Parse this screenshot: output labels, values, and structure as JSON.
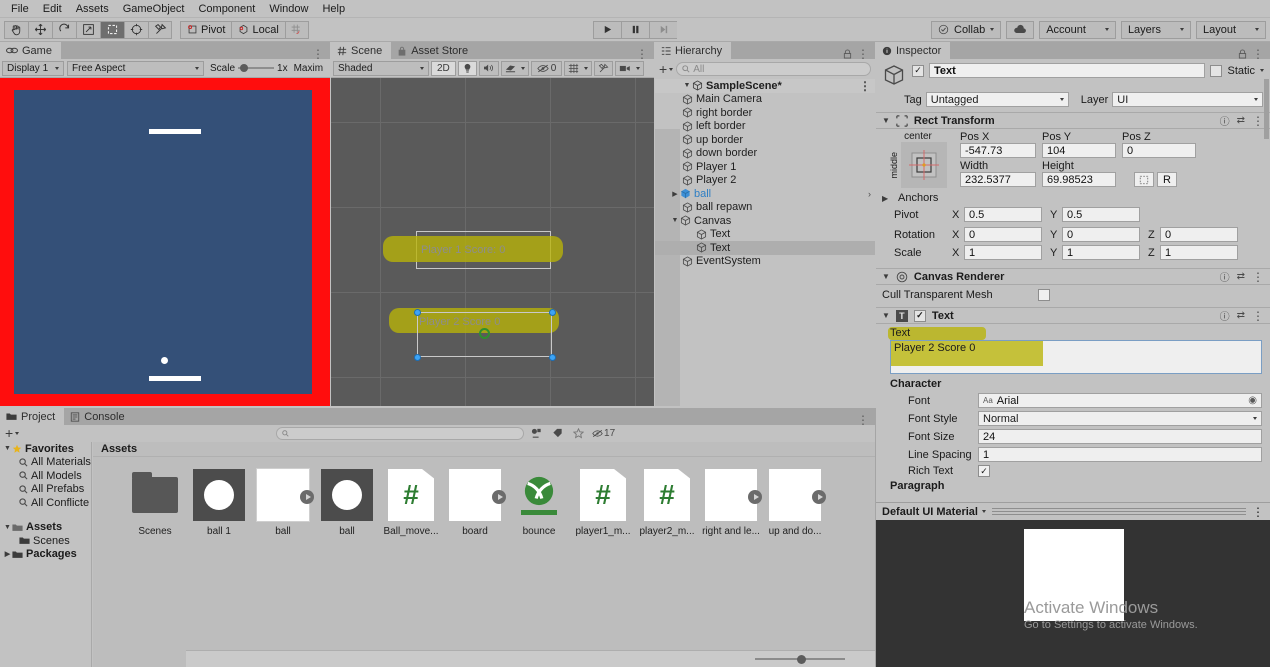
{
  "menubar": {
    "items": [
      "File",
      "Edit",
      "Assets",
      "GameObject",
      "Component",
      "Window",
      "Help"
    ]
  },
  "toolbar": {
    "tools": [
      "hand-tool",
      "move-tool",
      "rotate-tool",
      "scale-tool",
      "rect-tool",
      "transform-tool",
      "custom-tool"
    ],
    "pivot_label": "Pivot",
    "local_label": "Local",
    "play_label": "▶",
    "pause_label": "▐▐",
    "step_label": "▶|",
    "collab_label": "Collab",
    "cloud_label": "cloud-icon",
    "account_label": "Account",
    "layers_label": "Layers",
    "layout_label": "Layout"
  },
  "game_panel": {
    "tab_label": "Game",
    "display_label": "Display 1",
    "aspect_label": "Free Aspect",
    "scale_label": "Scale",
    "scale_value": "1x",
    "maximize_label": "Maxim"
  },
  "scene_panel": {
    "tabs": [
      {
        "label": "Scene",
        "selected": true
      },
      {
        "label": "Asset Store",
        "selected": false
      }
    ],
    "shading_label": "Shaded",
    "mode_2d_label": "2D",
    "light_icon": "lightbulb-icon",
    "audio_icon": "speaker-icon",
    "fx_icon": "effects-icon",
    "hidden_count": "0",
    "grid_icon": "grid-icon",
    "gizmo_icon": "gizmo-icon",
    "camera_icon": "camera-icon",
    "labels": [
      {
        "text": "Player 1 Score: 0"
      },
      {
        "text": "Player 2 Score 0"
      }
    ]
  },
  "hierarchy": {
    "tab_label": "Hierarchy",
    "create_label": "+",
    "search_placeholder": "All",
    "scene_name": "SampleScene*",
    "items": [
      {
        "label": "Main Camera",
        "depth": 1,
        "expandable": false,
        "selected": false,
        "prefab": false
      },
      {
        "label": "right border",
        "depth": 1,
        "expandable": false,
        "selected": false,
        "prefab": false
      },
      {
        "label": "left border",
        "depth": 1,
        "expandable": false,
        "selected": false,
        "prefab": false
      },
      {
        "label": "up border",
        "depth": 1,
        "expandable": false,
        "selected": false,
        "prefab": false
      },
      {
        "label": "down border",
        "depth": 1,
        "expandable": false,
        "selected": false,
        "prefab": false
      },
      {
        "label": "Player 1",
        "depth": 1,
        "expandable": false,
        "selected": false,
        "prefab": false
      },
      {
        "label": "Player 2",
        "depth": 1,
        "expandable": false,
        "selected": false,
        "prefab": false
      },
      {
        "label": "ball",
        "depth": 1,
        "expandable": true,
        "selected": false,
        "prefab": true
      },
      {
        "label": "ball repawn",
        "depth": 1,
        "expandable": false,
        "selected": false,
        "prefab": false
      },
      {
        "label": "Canvas",
        "depth": 1,
        "expandable": true,
        "expanded": true,
        "selected": false,
        "prefab": false
      },
      {
        "label": "Text",
        "depth": 2,
        "expandable": false,
        "selected": false,
        "prefab": false
      },
      {
        "label": "Text",
        "depth": 2,
        "expandable": false,
        "selected": true,
        "prefab": false
      },
      {
        "label": "EventSystem",
        "depth": 1,
        "expandable": false,
        "selected": false,
        "prefab": false
      }
    ]
  },
  "inspector": {
    "tab_label": "Inspector",
    "object_name": "Text",
    "enabled": true,
    "static_label": "Static",
    "tag_label": "Tag",
    "tag_value": "Untagged",
    "layer_label": "Layer",
    "layer_value": "UI",
    "rect_transform": {
      "title": "Rect Transform",
      "anchor_preset_top": "center",
      "anchor_preset_side": "middle",
      "pos_x_label": "Pos X",
      "pos_y_label": "Pos Y",
      "pos_z_label": "Pos Z",
      "pos_x": "-547.73",
      "pos_y": "104",
      "pos_z": "0",
      "width_label": "Width",
      "height_label": "Height",
      "width": "232.5377",
      "height": "69.98523",
      "blueprint_label": "R",
      "anchors_label": "Anchors",
      "pivot_label": "Pivot",
      "pivot_x": "0.5",
      "pivot_y": "0.5",
      "rotation_label": "Rotation",
      "rot_x": "0",
      "rot_y": "0",
      "rot_z": "0",
      "scale_label": "Scale",
      "scale_x": "1",
      "scale_y": "1",
      "scale_z": "1"
    },
    "canvas_renderer": {
      "title": "Canvas Renderer",
      "cull_label": "Cull Transparent Mesh",
      "cull_checked": false
    },
    "text_component": {
      "title": "Text",
      "enabled": true,
      "text_label": "Text",
      "text_value": "Player 2 Score 0",
      "character_label": "Character",
      "font_label": "Font",
      "font_value": "Arial",
      "font_style_label": "Font Style",
      "font_style_value": "Normal",
      "font_size_label": "Font Size",
      "font_size_value": "24",
      "line_spacing_label": "Line Spacing",
      "line_spacing_value": "1",
      "rich_text_label": "Rich Text",
      "rich_text_checked": true,
      "paragraph_label": "Paragraph"
    },
    "material_label": "Default UI Material",
    "watermark_title": "Activate Windows",
    "watermark_sub": "Go to Settings to activate Windows."
  },
  "project": {
    "tabs": [
      {
        "label": "Project",
        "selected": true
      },
      {
        "label": "Console",
        "selected": false
      }
    ],
    "create_label": "+",
    "search_placeholder": "",
    "filter_icons": [
      "asset-filter-icon",
      "label-filter-icon",
      "favorite-star-icon"
    ],
    "hidden_count": "17",
    "tree": [
      {
        "label": "Favorites",
        "bold": true,
        "depth": 0,
        "tri": "▼",
        "star": true
      },
      {
        "label": "All Materials",
        "bold": false,
        "depth": 1,
        "search": true
      },
      {
        "label": "All Models",
        "bold": false,
        "depth": 1,
        "search": true
      },
      {
        "label": "All Prefabs",
        "bold": false,
        "depth": 1,
        "search": true
      },
      {
        "label": "All Conflicte",
        "bold": false,
        "depth": 1,
        "search": true
      },
      {
        "label": "",
        "spacer": true
      },
      {
        "label": "Assets",
        "bold": true,
        "depth": 0,
        "tri": "▼",
        "folder": true
      },
      {
        "label": "Scenes",
        "bold": false,
        "depth": 1,
        "folder": true
      },
      {
        "label": "Packages",
        "bold": true,
        "depth": 0,
        "tri": "▶",
        "folder": true
      }
    ],
    "breadcrumb": "Assets",
    "assets": [
      {
        "name": "Scenes",
        "kind": "folder",
        "selected": false
      },
      {
        "name": "ball 1",
        "kind": "sprite-dark",
        "selected": false
      },
      {
        "name": "ball",
        "kind": "prefab-white",
        "selected": true
      },
      {
        "name": "ball",
        "kind": "sprite-dark",
        "selected": false
      },
      {
        "name": "Ball_move...",
        "kind": "script",
        "selected": false
      },
      {
        "name": "board",
        "kind": "prefab-white",
        "selected": false
      },
      {
        "name": "bounce",
        "kind": "physics-material",
        "selected": false
      },
      {
        "name": "player1_m...",
        "kind": "script",
        "selected": false
      },
      {
        "name": "player2_m...",
        "kind": "script",
        "selected": false
      },
      {
        "name": "right and le...",
        "kind": "prefab-white",
        "selected": false
      },
      {
        "name": "up and do...",
        "kind": "prefab-white",
        "selected": false
      }
    ]
  }
}
